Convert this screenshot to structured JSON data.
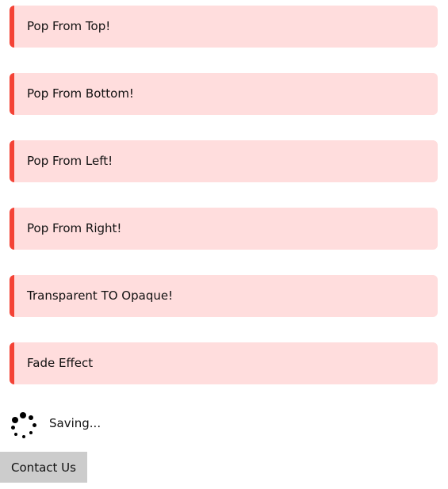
{
  "alerts": [
    {
      "label": "Pop From Top!"
    },
    {
      "label": "Pop From Bottom!"
    },
    {
      "label": "Pop From Left!"
    },
    {
      "label": "Pop From Right!"
    },
    {
      "label": "Transparent TO Opaque!"
    },
    {
      "label": "Fade Effect"
    }
  ],
  "status": {
    "saving_text": "Saving...",
    "icon": "loading-spinner-icon"
  },
  "contact": {
    "label": "Contact Us"
  },
  "colors": {
    "alert_bg": "#ffdddd",
    "alert_border": "#f44336",
    "button_bg": "#cccccc"
  }
}
